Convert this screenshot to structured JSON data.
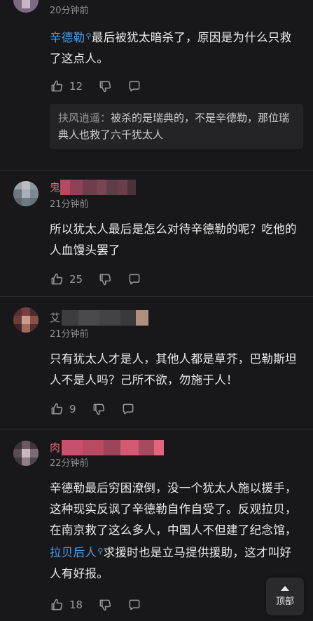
{
  "comments": [
    {
      "time": "20分钟前",
      "content_link": "辛德勒",
      "content_rest": "最后被犹太暗杀了，原因是为什么只救了这点人。",
      "likes": "12",
      "reply": {
        "name": "扶风逍遥",
        "sep": "：",
        "text": "被杀的是瑞典的，不是辛德勒，那位瑞典人也救了六千犹太人"
      }
    },
    {
      "name_start": "鬼",
      "time": "21分钟前",
      "content": "所以犹太人最后是怎么对待辛德勒的呢？吃他的人血馒头罢了",
      "likes": "25"
    },
    {
      "name_start": "艾",
      "time": "21分钟前",
      "content": "只有犹太人才是人，其他人都是草芥，巴勒斯坦人不是人吗？己所不欲，勿施于人！",
      "likes": "9"
    },
    {
      "name_start": "肉",
      "time": "22分钟前",
      "content_a": "辛德勒最后穷困潦倒，没一个犹太人施以援手，这种现实反讽了辛德勒自作自受了。反观拉贝，在南京救了这么多人，中国人不但建了纪念馆，",
      "content_link": "拉贝后人",
      "content_b": "求援时也是立马提供援助，这才叫好人有好报。",
      "likes": "18"
    }
  ],
  "top_button": {
    "label": "顶部"
  },
  "icons": [
    "thumb-up-icon",
    "thumb-down-icon",
    "comment-icon",
    "search-icon",
    "arrow-up-icon"
  ],
  "colors": {
    "background": "#18181a",
    "link": "#4e9fe3",
    "name_pink": "#e8627a",
    "muted": "#8f8f93"
  }
}
